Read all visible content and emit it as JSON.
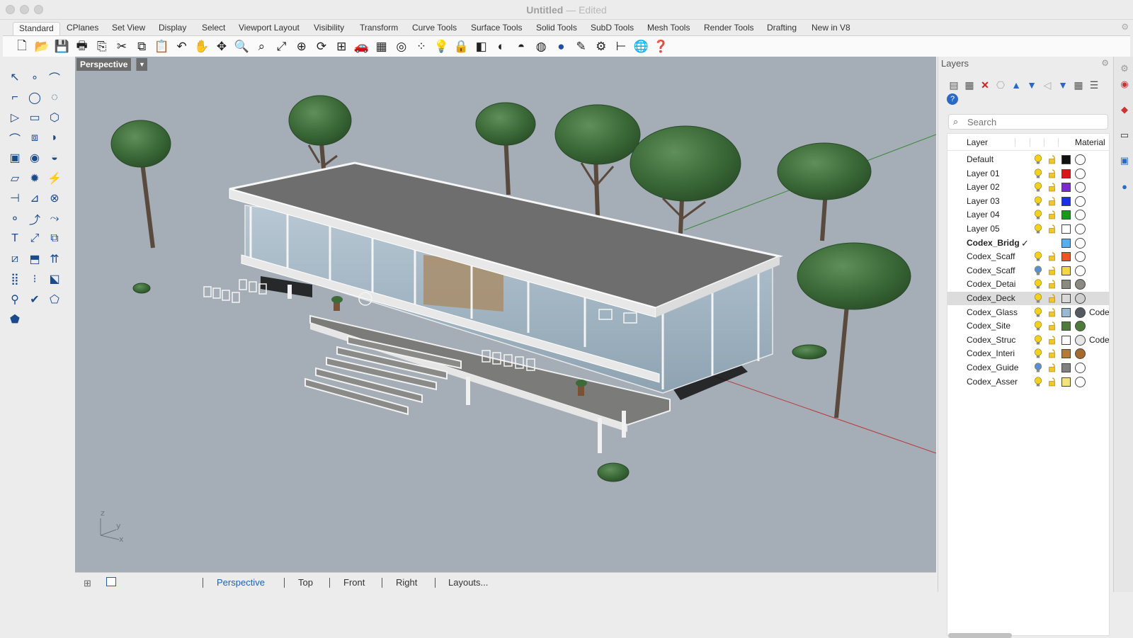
{
  "window": {
    "title": "Untitled",
    "status": "— Edited"
  },
  "tabs": [
    "Standard",
    "CPlanes",
    "Set View",
    "Display",
    "Select",
    "Viewport Layout",
    "Visibility",
    "Transform",
    "Curve Tools",
    "Surface Tools",
    "Solid Tools",
    "SubD Tools",
    "Mesh Tools",
    "Render Tools",
    "Drafting",
    "New in V8"
  ],
  "active_tab": "Standard",
  "viewport": {
    "name": "Perspective",
    "axis": {
      "z": "z",
      "y": "y",
      "x": "x"
    }
  },
  "viewport_tabs": {
    "active": "Perspective",
    "items": [
      "Perspective",
      "Top",
      "Front",
      "Right",
      "Layouts..."
    ]
  },
  "layers_panel": {
    "title": "Layers",
    "search_placeholder": "Search",
    "col_layer": "Layer",
    "col_material": "Material",
    "rows": [
      {
        "name": "Default",
        "color": "#111111",
        "mat": "#ffffff",
        "bulb": "#f2d21b",
        "mattxt": ""
      },
      {
        "name": "Layer 01",
        "color": "#d81818",
        "mat": "#ffffff",
        "bulb": "#f2d21b",
        "mattxt": ""
      },
      {
        "name": "Layer 02",
        "color": "#7a2bd0",
        "mat": "#ffffff",
        "bulb": "#f2d21b",
        "mattxt": ""
      },
      {
        "name": "Layer 03",
        "color": "#1a2fe8",
        "mat": "#ffffff",
        "bulb": "#f2d21b",
        "mattxt": ""
      },
      {
        "name": "Layer 04",
        "color": "#159a1a",
        "mat": "#ffffff",
        "bulb": "#f2d21b",
        "mattxt": ""
      },
      {
        "name": "Layer 05",
        "color": "#ffffff",
        "mat": "#ffffff",
        "bulb": "#f2d21b",
        "mattxt": ""
      },
      {
        "name": "Codex_Bridg",
        "color": "#57aef0",
        "mat": "#ffffff",
        "bulb": "",
        "mattxt": "",
        "current": true
      },
      {
        "name": "Codex_Scaff",
        "color": "#ee5522",
        "mat": "#ffffff",
        "bulb": "#f2d21b",
        "mattxt": ""
      },
      {
        "name": "Codex_Scaff",
        "color": "#f4d64a",
        "mat": "#ffffff",
        "bulb": "#5a8fd8",
        "mattxt": ""
      },
      {
        "name": "Codex_Detai",
        "color": "#8a8a80",
        "mat": "#8a8a80",
        "bulb": "#f2d21b",
        "mattxt": ""
      },
      {
        "name": "Codex_Deck",
        "color": "#d8d8d8",
        "mat": "#cfcfcf",
        "bulb": "#f2d21b",
        "mattxt": "",
        "selected": true
      },
      {
        "name": "Codex_Glass",
        "color": "#9ab8d0",
        "mat": "#555a60",
        "bulb": "#f2d21b",
        "mattxt": "Code"
      },
      {
        "name": "Codex_Site",
        "color": "#4e7a3c",
        "mat": "#4e7a3c",
        "bulb": "#f2d21b",
        "mattxt": ""
      },
      {
        "name": "Codex_Struc",
        "color": "#ffffff",
        "mat": "#e6e6e6",
        "bulb": "#f2d21b",
        "mattxt": "Code"
      },
      {
        "name": "Codex_Interi",
        "color": "#b57a38",
        "mat": "#a86a2a",
        "bulb": "#f2d21b",
        "mattxt": ""
      },
      {
        "name": "Codex_Guide",
        "color": "#808080",
        "mat": "#ffffff",
        "bulb": "#5a8fd8",
        "mattxt": ""
      },
      {
        "name": "Codex_Asser",
        "color": "#f4e27a",
        "mat": "#ffffff",
        "bulb": "#f2d21b",
        "mattxt": ""
      }
    ]
  },
  "toolbar_icons": [
    "new-file",
    "open-file",
    "save",
    "print",
    "import",
    "cut",
    "copy",
    "paste",
    "undo",
    "pan",
    "rotate-view",
    "zoom",
    "zoom-window",
    "zoom-extents",
    "zoom-selected",
    "rotate-camera",
    "four-viewports",
    "car",
    "grid",
    "osnap",
    "point-cloud",
    "light-bulb",
    "lock",
    "surface",
    "color-wheel",
    "sphere-shade",
    "sphere-render",
    "blue-sphere",
    "draw-curve",
    "gear",
    "dimension",
    "green-globe",
    "help"
  ],
  "colors": {
    "viewport_bg": "#a5adb6",
    "accent": "#1e5fb3"
  }
}
